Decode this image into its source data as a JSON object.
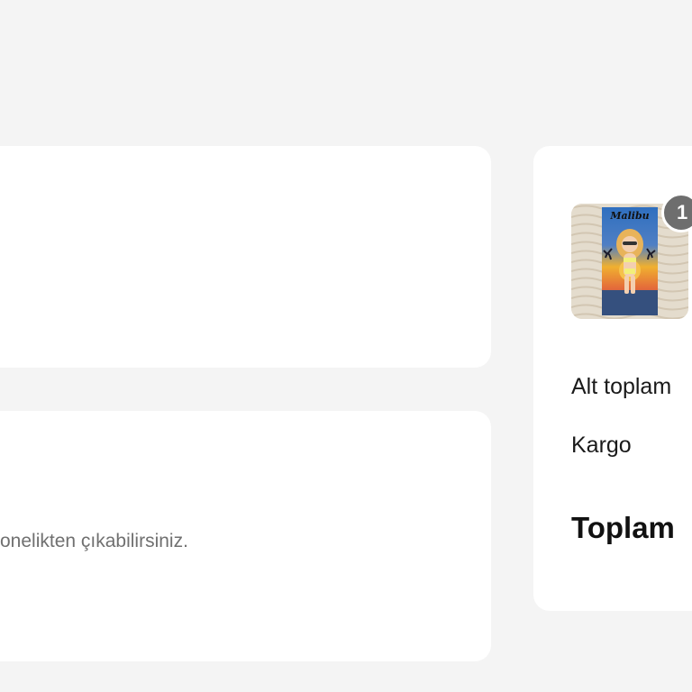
{
  "main": {
    "subscription_note": "onelikten çıkabilirsiniz."
  },
  "summary": {
    "item_quantity_badge": "1",
    "product_image_icon": "beach-towel-product-image",
    "subtotal_label": "Alt toplam",
    "shipping_label": "Kargo",
    "total_label": "Toplam"
  },
  "colors": {
    "page_background": "#f4f4f4",
    "card_background": "#ffffff",
    "badge_background": "#6e6e6e",
    "muted_text": "#707070"
  }
}
